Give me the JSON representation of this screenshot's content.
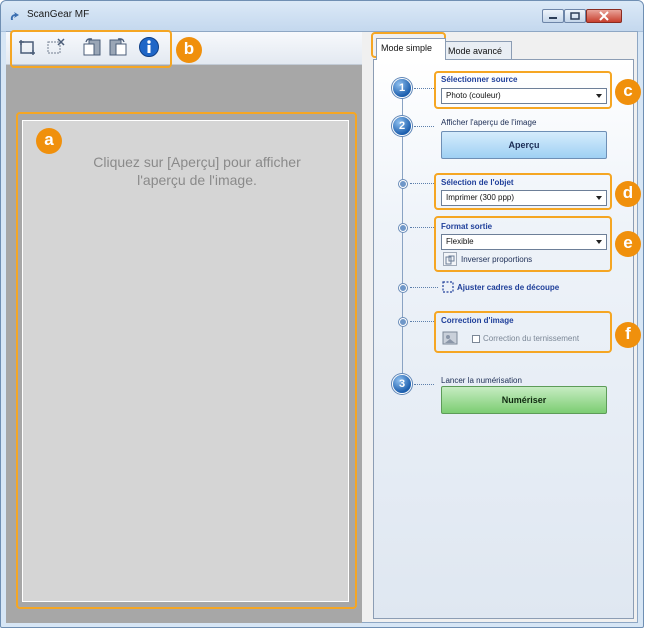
{
  "window": {
    "title": "ScanGear MF",
    "controls": [
      "minimize-button",
      "maximize-button",
      "close-button"
    ]
  },
  "toolbar": {
    "buttons": [
      "crop-icon",
      "remove-crop-icon",
      "rotate-left-icon",
      "rotate-right-icon",
      "info-icon"
    ]
  },
  "preview": {
    "message": "Cliquez sur [Aperçu] pour afficher l'aperçu de l'image."
  },
  "tabs": [
    {
      "label": "Mode simple",
      "active": true
    },
    {
      "label": "Mode avancé",
      "active": false
    }
  ],
  "steps": {
    "step1": {
      "number": "1",
      "label": "Sélectionner source",
      "value": "Photo (couleur)"
    },
    "step2": {
      "number": "2",
      "label": "Afficher l'aperçu de l'image",
      "button": "Aperçu"
    },
    "object": {
      "label": "Sélection de l'objet",
      "value": "Imprimer (300 ppp)"
    },
    "output": {
      "label": "Format sortie",
      "value": "Flexible",
      "swap_label": "Inverser proportions"
    },
    "crop": {
      "label": "Ajuster cadres de découpe"
    },
    "correction": {
      "label": "Correction d'image",
      "checkbox_label": "Correction du ternissement",
      "checked": false
    },
    "step3": {
      "number": "3",
      "label": "Lancer la numérisation",
      "button": "Numériser"
    }
  },
  "callouts": {
    "a": "a",
    "b": "b",
    "c": "c",
    "d": "d",
    "e": "e",
    "f": "f"
  },
  "colors": {
    "callout": "#f5a623",
    "badge": "#f0900c",
    "preview_bg": "#a7a7a7",
    "scan_button": "#7ccd72",
    "preview_button": "#9fd0f3"
  }
}
